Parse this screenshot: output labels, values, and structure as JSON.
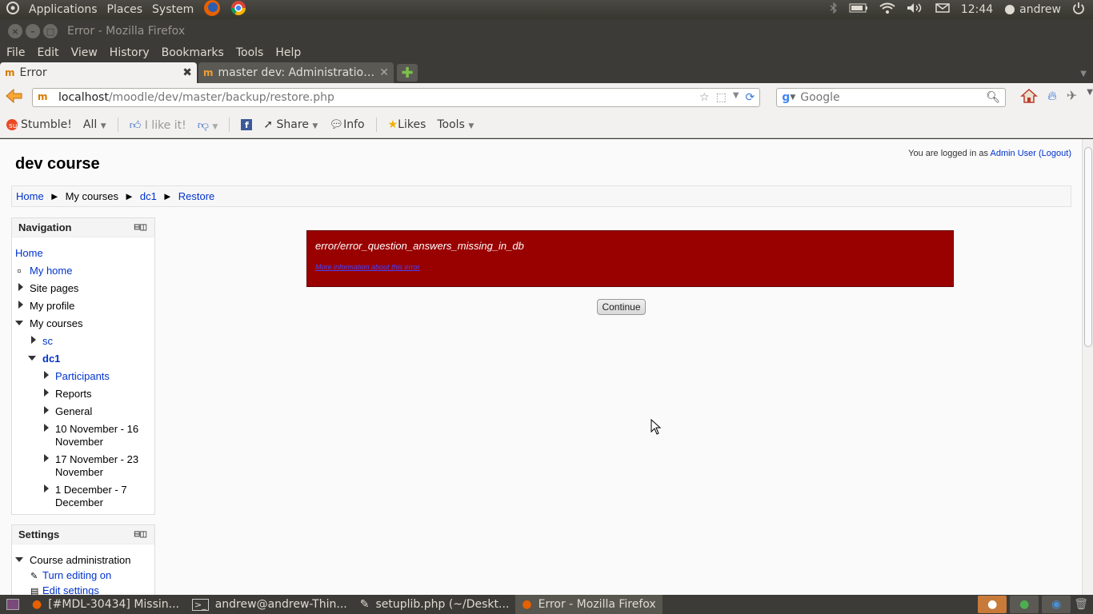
{
  "top_panel": {
    "menus": [
      "Applications",
      "Places",
      "System"
    ],
    "clock": "12:44",
    "user": "andrew"
  },
  "window": {
    "title": "Error - Mozilla Firefox"
  },
  "menubar": [
    "File",
    "Edit",
    "View",
    "History",
    "Bookmarks",
    "Tools",
    "Help"
  ],
  "tabs": [
    {
      "label": "Error",
      "active": true
    },
    {
      "label": "master dev: Administration...",
      "active": false
    }
  ],
  "address": {
    "host": "localhost",
    "path": "/moodle/dev/master/backup/restore.php"
  },
  "search": {
    "placeholder": "Google"
  },
  "stumblebar": {
    "stumble": "Stumble!",
    "all": "All",
    "like": "I like it!",
    "share": "Share",
    "info": "Info",
    "likes": "Likes",
    "tools": "Tools"
  },
  "page": {
    "course_title": "dev course",
    "login_prefix": "You are logged in as",
    "login_user": "Admin User",
    "logout": "(Logout)",
    "breadcrumb": [
      "Home",
      "My courses",
      "dc1",
      "Restore"
    ],
    "error_message": "error/error_question_answers_missing_in_db",
    "more_info": "More information about this error",
    "continue_label": "Continue"
  },
  "navigation": {
    "header": "Navigation",
    "home": "Home",
    "my_home": "My home",
    "site_pages": "Site pages",
    "my_profile": "My profile",
    "my_courses": "My courses",
    "sc": "sc",
    "dc1": "dc1",
    "participants": "Participants",
    "reports": "Reports",
    "general": "General",
    "week1a": "10 November - 16",
    "week1b": "November",
    "week2a": "17 November - 23",
    "week2b": "November",
    "week3a": "1 December - 7",
    "week3b": "December"
  },
  "settings": {
    "header": "Settings",
    "course_admin": "Course administration",
    "turn_editing": "Turn editing on",
    "edit_settings": "Edit settings"
  },
  "taskbar": [
    {
      "label": "[#MDL-30434] Missin...",
      "icon": "firefox-icon"
    },
    {
      "label": "andrew@andrew-Thin...",
      "icon": "terminal-icon"
    },
    {
      "label": "setuplib.php (~/Deskt...",
      "icon": "editor-icon"
    },
    {
      "label": "Error - Mozilla Firefox",
      "icon": "firefox-icon",
      "active": true
    }
  ]
}
